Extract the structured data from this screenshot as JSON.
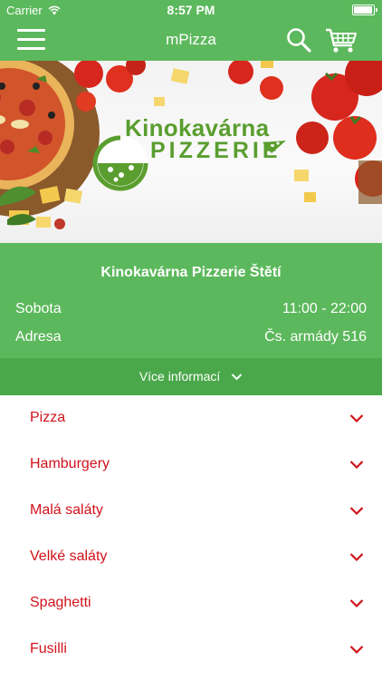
{
  "status_bar": {
    "carrier": "Carrier",
    "time": "8:57 PM"
  },
  "navbar": {
    "title": "mPizza",
    "icons": [
      "hamburger-menu-icon",
      "search-icon",
      "cart-icon"
    ]
  },
  "hero": {
    "logo_line1": "Kinokavárna",
    "logo_line2": "PIZZERIE"
  },
  "restaurant": {
    "name": "Kinokavárna Pizzerie Štětí",
    "hours_label": "Sobota",
    "hours_value": "11:00 - 22:00",
    "address_label": "Adresa",
    "address_value": "Čs. armády 516"
  },
  "more_info": {
    "label": "Více informací"
  },
  "categories": [
    {
      "label": "Pizza"
    },
    {
      "label": "Hamburgery"
    },
    {
      "label": "Malá saláty"
    },
    {
      "label": "Velké saláty"
    },
    {
      "label": "Spaghetti"
    },
    {
      "label": "Fusilli"
    }
  ],
  "colors": {
    "brand_green": "#5cb85c",
    "dark_green": "#4aa84a",
    "category_red": "#d0121b",
    "logo_green": "#5a9e2f"
  }
}
